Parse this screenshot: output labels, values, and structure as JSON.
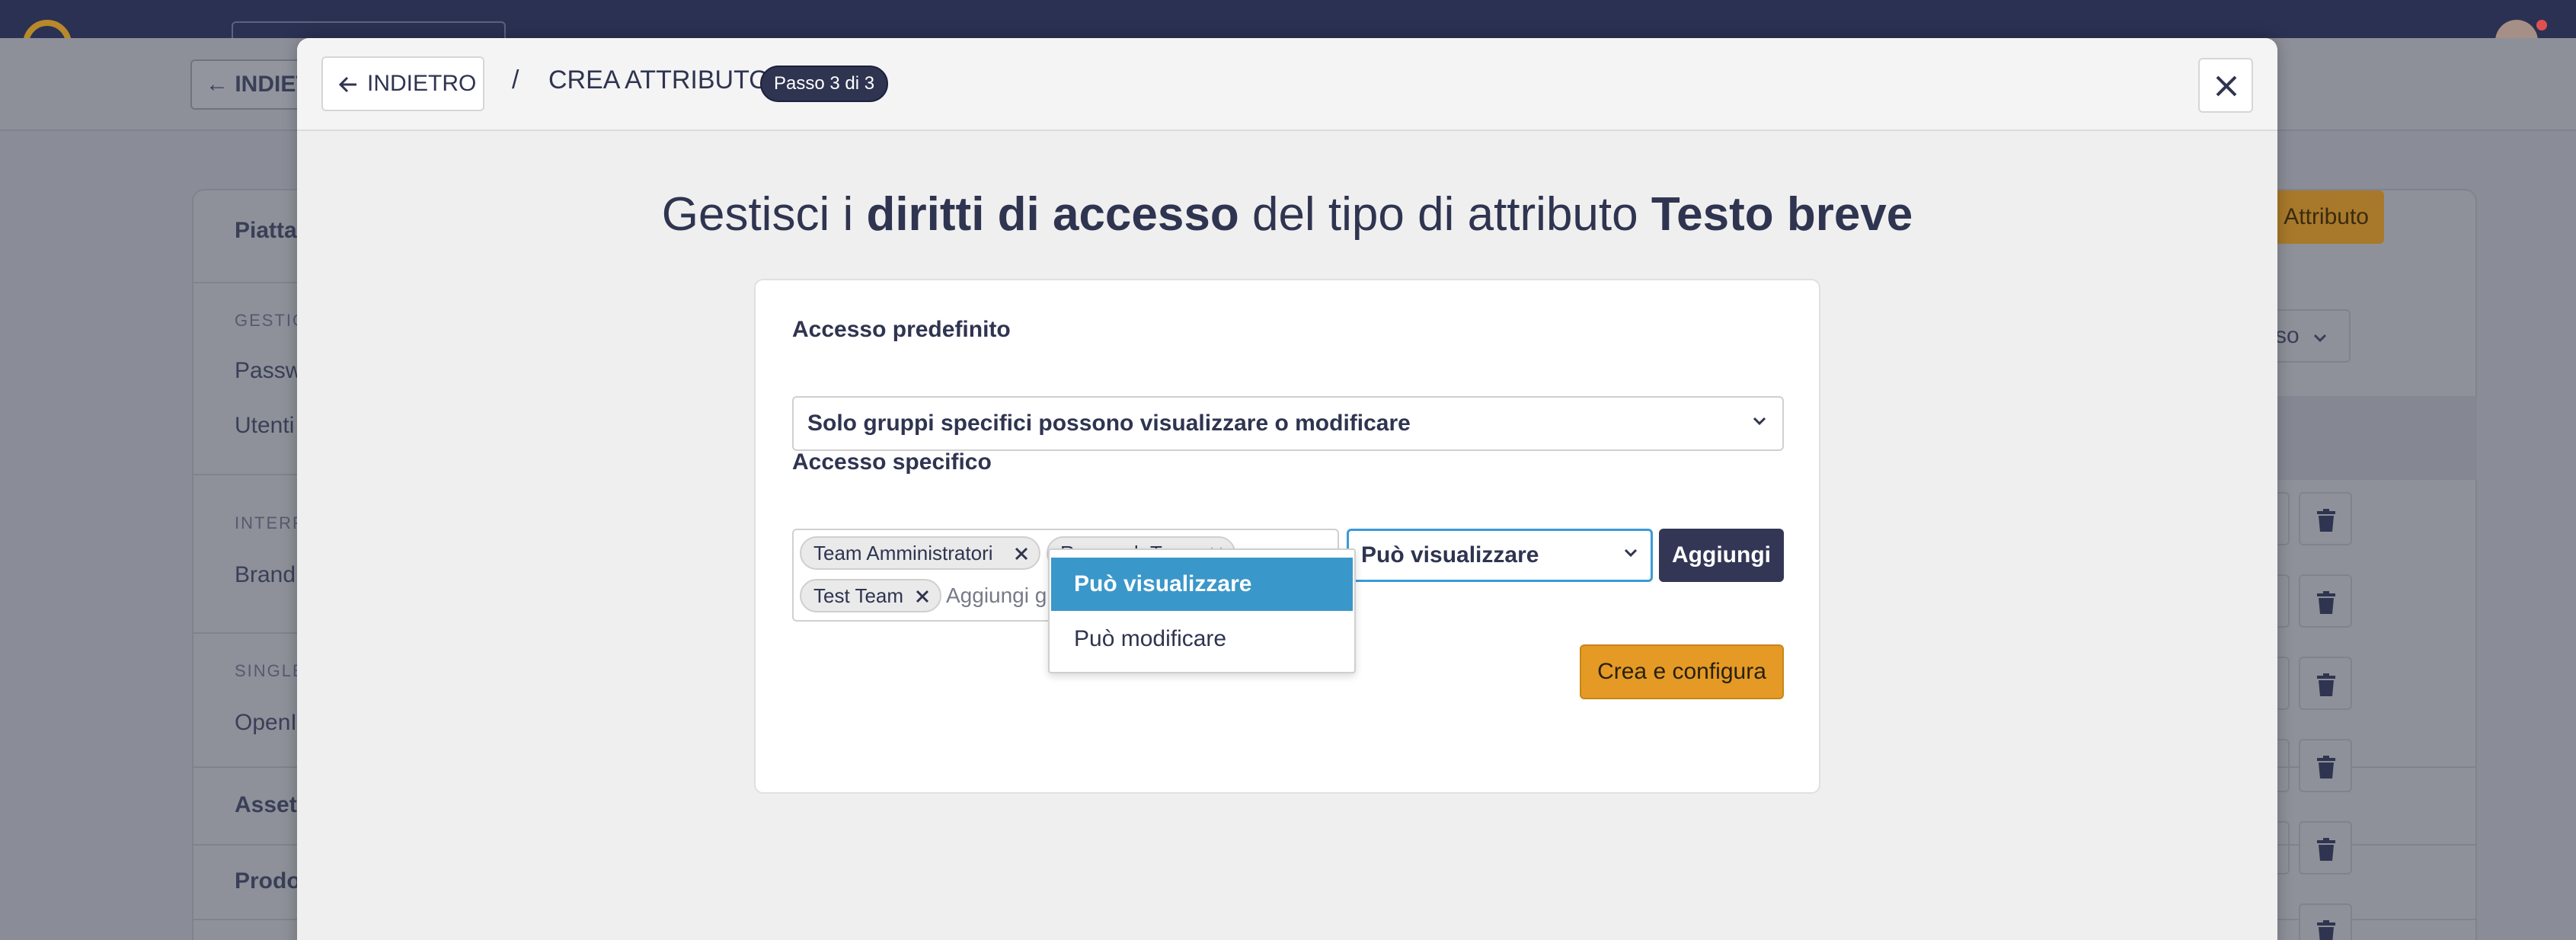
{
  "background": {
    "back_label": "INDIET",
    "panel_title": "Piatta",
    "section_gestione": "GESTIO",
    "item_password": "Passw",
    "item_utenti": "Utenti",
    "section_interfaccia": "INTERF",
    "item_brand": "Brand",
    "section_single": "SINGLE",
    "item_openid": "OpenI",
    "item_asset": "Asset",
    "item_prodotti": "Prodo",
    "add_attribute_label": "Attributo",
    "filter_select_label": "sso"
  },
  "modal": {
    "back_label": "INDIETRO",
    "breadcrumb_sep": "/",
    "title": "CREA ATTRIBUTO",
    "step_badge": "Passo 3 di 3",
    "headline": {
      "part1": "Gestisci i ",
      "bold1": "diritti di accesso",
      "part2": " del tipo di attributo ",
      "bold2": "Testo breve"
    },
    "default_access": {
      "label": "Accesso predefinito",
      "value": "Solo gruppi specifici possono visualizzare o modificare"
    },
    "specific_access": {
      "label": "Accesso specifico",
      "tags": [
        "Team Amministratori",
        "Research Team",
        "Test Team"
      ],
      "placeholder": "Aggiungi gruppo di utenti",
      "permission_value": "Può visualizzare",
      "add_label": "Aggiungi",
      "options": [
        "Può visualizzare",
        "Può modificare"
      ]
    },
    "create_label": "Crea e configura"
  },
  "colors": {
    "primary_dark": "#2f3450",
    "accent_orange": "#e49a24",
    "focus_blue": "#3a9ad9",
    "option_selected": "#3a97c9"
  }
}
